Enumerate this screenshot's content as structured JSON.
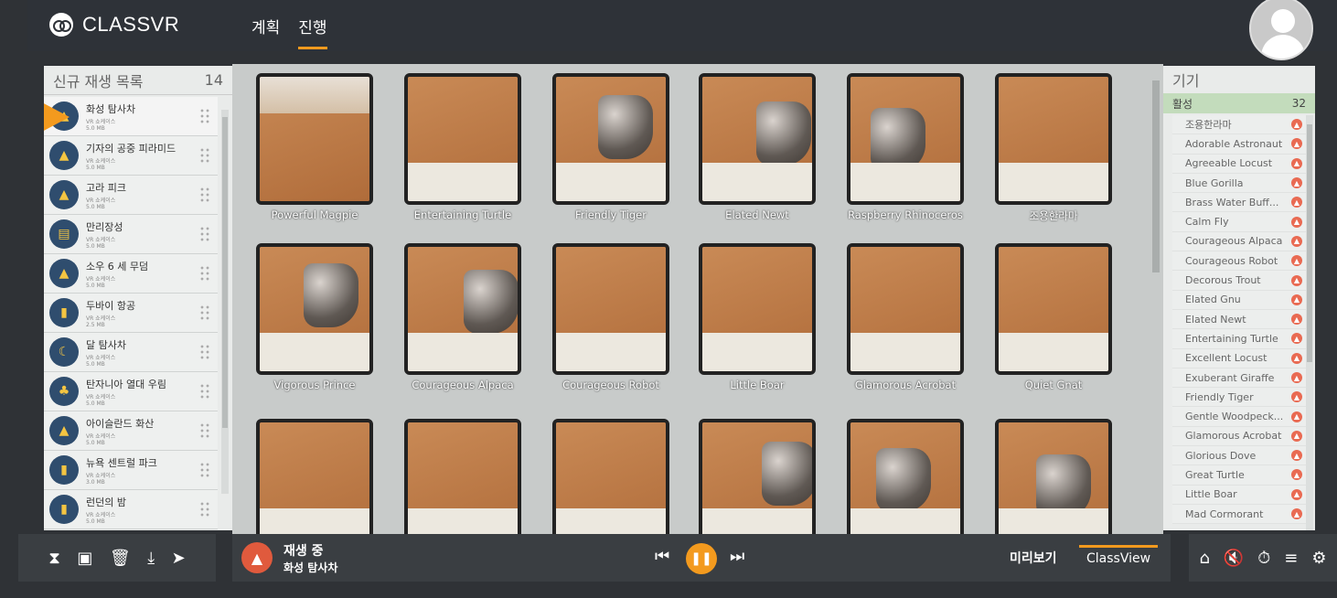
{
  "app": {
    "logo": "CLASSVR"
  },
  "top_tabs": [
    {
      "label": "계획",
      "active": false
    },
    {
      "label": "진행",
      "active": true
    }
  ],
  "playlist": {
    "title": "신규 재생 목록",
    "count": "14",
    "items": [
      {
        "name": "화성 탐사차",
        "sub": "VR 쇼케이스",
        "size": "5.0 MB",
        "icon": "rover-icon",
        "active": true
      },
      {
        "name": "기자의 공중 피라미드",
        "sub": "VR 쇼케이스",
        "size": "5.0 MB",
        "icon": "pyramid-icon"
      },
      {
        "name": "고라 피크",
        "sub": "VR 쇼케이스",
        "size": "5.0 MB",
        "icon": "mountain-icon"
      },
      {
        "name": "만리장성",
        "sub": "VR 쇼케이스",
        "size": "5.0 MB",
        "icon": "great-wall-icon"
      },
      {
        "name": "소우 6 세 무덤",
        "sub": "VR 쇼케이스",
        "size": "5.0 MB",
        "icon": "tomb-icon"
      },
      {
        "name": "두바이 항공",
        "sub": "VR 쇼케이스",
        "size": "2.5 MB",
        "icon": "skyscraper-icon"
      },
      {
        "name": "달 탐사차",
        "sub": "VR 쇼케이스",
        "size": "5.0 MB",
        "icon": "moon-icon"
      },
      {
        "name": "탄자니아 열대 우림",
        "sub": "VR 쇼케이스",
        "size": "5.0 MB",
        "icon": "palm-icon"
      },
      {
        "name": "아이슬란드 화산",
        "sub": "VR 쇼케이스",
        "size": "5.0 MB",
        "icon": "volcano-icon"
      },
      {
        "name": "뉴욕 센트럴 파크",
        "sub": "VR 쇼케이스",
        "size": "3.0 MB",
        "icon": "park-icon"
      },
      {
        "name": "런던의 밤",
        "sub": "VR 쇼케이스",
        "size": "5.0 MB",
        "icon": "big-ben-icon"
      }
    ]
  },
  "tiles": [
    {
      "label": "Powerful Magpie",
      "scene": "landscape"
    },
    {
      "label": "Entertaining Turtle",
      "scene": "ground"
    },
    {
      "label": "Friendly Tiger",
      "scene": "rover"
    },
    {
      "label": "Elated Newt",
      "scene": "rover"
    },
    {
      "label": "Raspberry Rhinoceros",
      "scene": "rover"
    },
    {
      "label": "조용한라마",
      "scene": "ground"
    },
    {
      "label": "Vigorous Prince",
      "scene": "rover"
    },
    {
      "label": "Courageous Alpaca",
      "scene": "rover"
    },
    {
      "label": "Courageous Robot",
      "scene": "ground"
    },
    {
      "label": "Little Boar",
      "scene": "ground"
    },
    {
      "label": "Glamorous Acrobat",
      "scene": "ground"
    },
    {
      "label": "Quiet Gnat",
      "scene": "ground"
    },
    {
      "label": "",
      "scene": "ground"
    },
    {
      "label": "",
      "scene": "ground"
    },
    {
      "label": "",
      "scene": "ground"
    },
    {
      "label": "",
      "scene": "rover"
    },
    {
      "label": "",
      "scene": "rover"
    },
    {
      "label": "",
      "scene": "rover"
    }
  ],
  "player": {
    "status": "재생 중",
    "title": "화성 탐사차",
    "preview_label": "미리보기",
    "classview_label": "ClassView"
  },
  "devices": {
    "title": "기기",
    "active_label": "활성",
    "active_count": "32",
    "items": [
      "조용한라마",
      "Adorable Astronaut",
      "Agreeable Locust",
      "Blue Gorilla",
      "Brass Water Buff...",
      "Calm Fly",
      "Courageous Alpaca",
      "Courageous Robot",
      "Decorous Trout",
      "Elated Gnu",
      "Elated Newt",
      "Entertaining Turtle",
      "Excellent Locust",
      "Exuberant Giraffe",
      "Friendly Tiger",
      "Gentle Woodpeck...",
      "Glamorous Acrobat",
      "Glorious Dove",
      "Great Turtle",
      "Little Boar",
      "Mad Cormorant"
    ]
  },
  "colors": {
    "accent": "#f39a1e",
    "badge": "#e96a52",
    "active_row": "#c3dcbc"
  }
}
